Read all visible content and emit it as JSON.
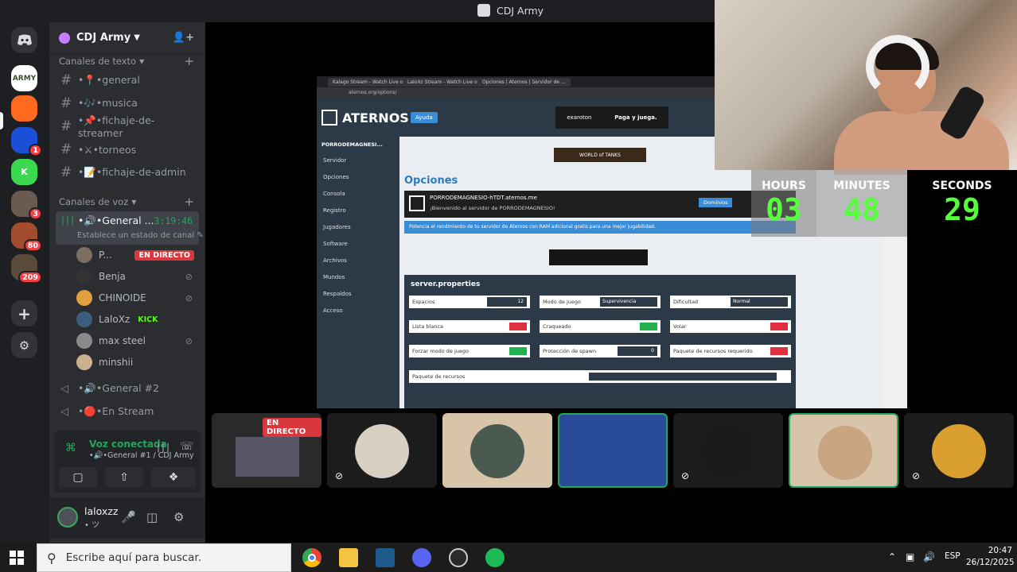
{
  "window": {
    "title": "CDJ Army"
  },
  "server_rail": {
    "servers": [
      {
        "label": "ARMY",
        "color": "#ffffff",
        "badge": ""
      },
      {
        "label": "",
        "color": "#ff6a1f",
        "badge": ""
      },
      {
        "label": "",
        "color": "#1b4fd8",
        "badge": "1"
      },
      {
        "label": "K",
        "color": "#3bd94f",
        "badge": ""
      },
      {
        "label": "",
        "color": "#6b5a50",
        "badge": "3"
      },
      {
        "label": "",
        "color": "#a34d2e",
        "badge": "80"
      },
      {
        "label": "",
        "color": "#5a4a3a",
        "badge": "209"
      }
    ]
  },
  "guild": {
    "name": "CDJ Army"
  },
  "text_category": "Canales de texto",
  "text_channels": [
    "•📍•general",
    "•🎶•musica",
    "•📌•fichaje-de-streamer",
    "•⚔•torneos",
    "•📝•fichaje-de-admin"
  ],
  "voice_category": "Canales de voz",
  "active_voice": {
    "name": "•🔊•General ...",
    "timer": "3:19:46",
    "status": "Establece un estado de canal"
  },
  "members": [
    {
      "name": "P...",
      "color": "#7c6f60",
      "live": "EN DIRECTO",
      "kick": "",
      "muted": false
    },
    {
      "name": "Benja",
      "color": "#333333",
      "live": "",
      "kick": "",
      "muted": true
    },
    {
      "name": "CHINOIDE",
      "color": "#e0a040",
      "live": "",
      "kick": "",
      "muted": true
    },
    {
      "name": "LaloXz",
      "color": "#3a5f7c",
      "live": "",
      "kick": "KICK",
      "muted": false
    },
    {
      "name": "max steel",
      "color": "#8a8a8a",
      "live": "",
      "kick": "",
      "muted": true
    },
    {
      "name": "minshii",
      "color": "#c9b08f",
      "live": "",
      "kick": "",
      "muted": false
    }
  ],
  "other_voice": [
    "•🔊•General #2",
    "•🔴•En Stream"
  ],
  "voice_panel": {
    "title": "Voz conectada",
    "subtitle": "•🔊•General #1 / CDJ Army"
  },
  "user": {
    "name": "laloxzz",
    "status": "• ツ"
  },
  "screen_share": {
    "brand": "ATERNOS",
    "help": "Ayuda",
    "ad_left": "exaroton",
    "ad_right": "Paga y juega.",
    "tabs": [
      "Kalago Stream - Watch Live on ...",
      "LaloXz Stream - Watch Live on ...",
      "Opciones | Aternos | Servidor de ..."
    ],
    "url": "aternos.org/options/",
    "server_short": "PORRODEMAGNESI...",
    "sidebar": [
      "Servidor",
      "Opciones",
      "Consola",
      "Registro",
      "Jugadores",
      "Software",
      "Archivos",
      "Mundos",
      "Respaldos",
      "Acceso"
    ],
    "wot": "WORLD of TANKS",
    "page_title": "Opciones",
    "server_addr": "PORRODEMAGNESIO-hTDT.aternos.me",
    "welcome": "¡Bienvenido al servidor de PORRODEMAGNESIO!",
    "domains": "Dominios",
    "ram_text": "Potencia el rendimiento de tu servidor de Aternos con RAM adicional gratis para una mejor jugabilidad.",
    "props_title": "server.properties",
    "props": [
      {
        "label": "Espacios",
        "kind": "num",
        "value": "12"
      },
      {
        "label": "Modo de juego",
        "kind": "sel",
        "value": "Supervivencia"
      },
      {
        "label": "Dificultad",
        "kind": "sel",
        "value": "Normal"
      },
      {
        "label": "Lista blanca",
        "kind": "off",
        "value": ""
      },
      {
        "label": "Craqueado",
        "kind": "on",
        "value": ""
      },
      {
        "label": "Volar",
        "kind": "off",
        "value": ""
      },
      {
        "label": "Forzar modo de juego",
        "kind": "on",
        "value": ""
      },
      {
        "label": "Protección de spawn",
        "kind": "num",
        "value": "0"
      },
      {
        "label": "Paquete de recursos requerido",
        "kind": "off",
        "value": ""
      }
    ],
    "resource_pack": "Paquete de recursos"
  },
  "timer_overlay": {
    "hours_label": "HOURS",
    "hours": "03",
    "minutes_label": "MINUTES",
    "minutes": "48",
    "seconds_label": "SECONDS",
    "seconds": "29"
  },
  "tiles": [
    {
      "live": "EN DIRECTO",
      "color": "#3a3a3a",
      "muted": false,
      "speaking": false
    },
    {
      "live": "",
      "color": "#d8cfc5",
      "muted": true,
      "speaking": false
    },
    {
      "live": "",
      "color": "#4a5a50",
      "muted": false,
      "speaking": false
    },
    {
      "live": "",
      "color": "#2a4a9a",
      "muted": false,
      "speaking": true
    },
    {
      "live": "",
      "color": "#1a1a1a",
      "muted": true,
      "speaking": false
    },
    {
      "live": "",
      "color": "#c8a580",
      "muted": false,
      "speaking": true
    },
    {
      "live": "",
      "color": "#d9a030",
      "muted": true,
      "speaking": false
    }
  ],
  "taskbar": {
    "search_placeholder": "Escribe aquí para buscar.",
    "lang": "ESP",
    "time": "20:47",
    "date": "26/12/2025"
  }
}
